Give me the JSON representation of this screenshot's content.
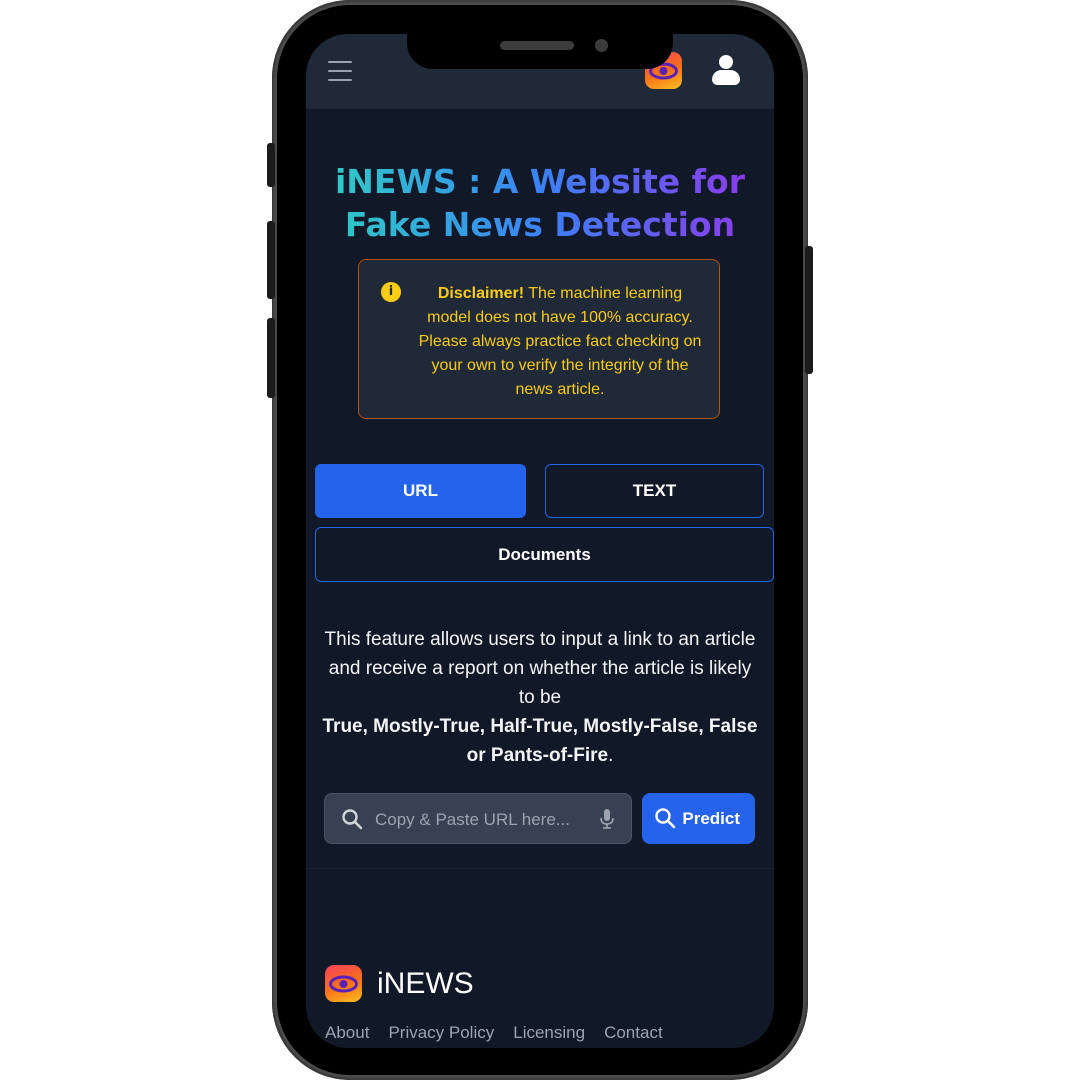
{
  "header": {
    "menu_icon": "hamburger-menu-icon",
    "logo_icon": "eye-logo-icon",
    "profile_icon": "user-profile-icon"
  },
  "hero": {
    "title_line1": "iNEWS : A Website for",
    "title_line2": "Fake News Detection"
  },
  "disclaimer": {
    "icon": "info-icon",
    "strong": "Disclaimer!",
    "text": " The machine learning model does not have 100% accuracy. Please always practice fact checking on your own to verify the integrity of the news article.",
    "accent_color": "#facc15"
  },
  "tabs": {
    "url": "URL",
    "text": "TEXT",
    "documents": "Documents",
    "active_color": "#2563eb"
  },
  "feature": {
    "description": "This feature allows users to input a link to an article and receive a report on whether the article is likely to be",
    "categories": "True, Mostly-True, Half-True, Mostly-False, False or Pants-of-Fire",
    "end": "."
  },
  "search": {
    "placeholder": "Copy & Paste URL here...",
    "value": "",
    "search_icon": "search-icon",
    "mic_icon": "microphone-icon",
    "predict_label": "Predict"
  },
  "footer": {
    "brand": "iNEWS",
    "links": [
      "About",
      "Privacy Policy",
      "Licensing",
      "Contact"
    ]
  }
}
